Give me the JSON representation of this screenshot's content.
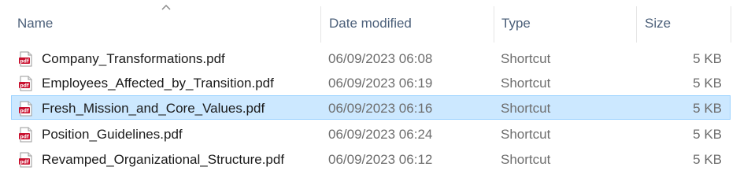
{
  "columns": {
    "name": "Name",
    "date_modified": "Date modified",
    "type": "Type",
    "size": "Size"
  },
  "sort": {
    "column": "name",
    "direction": "ascending"
  },
  "colors": {
    "selected_background": "#cce8ff",
    "selected_border": "#99d1ff",
    "pdf_icon": "#c8102e",
    "header_text": "#4c607a"
  },
  "files": [
    {
      "name": "Company_Transformations.pdf",
      "date_modified": "06/09/2023 06:08",
      "type": "Shortcut",
      "size": "5 KB",
      "icon": "pdf-icon",
      "selected": false
    },
    {
      "name": "Employees_Affected_by_Transition.pdf",
      "date_modified": "06/09/2023 06:19",
      "type": "Shortcut",
      "size": "5 KB",
      "icon": "pdf-icon",
      "selected": false
    },
    {
      "name": "Fresh_Mission_and_Core_Values.pdf",
      "date_modified": "06/09/2023 06:16",
      "type": "Shortcut",
      "size": "5 KB",
      "icon": "pdf-icon",
      "selected": true
    },
    {
      "name": "Position_Guidelines.pdf",
      "date_modified": "06/09/2023 06:24",
      "type": "Shortcut",
      "size": "5 KB",
      "icon": "pdf-icon",
      "selected": false
    },
    {
      "name": "Revamped_Organizational_Structure.pdf",
      "date_modified": "06/09/2023 06:12",
      "type": "Shortcut",
      "size": "5 KB",
      "icon": "pdf-icon",
      "selected": false
    }
  ]
}
